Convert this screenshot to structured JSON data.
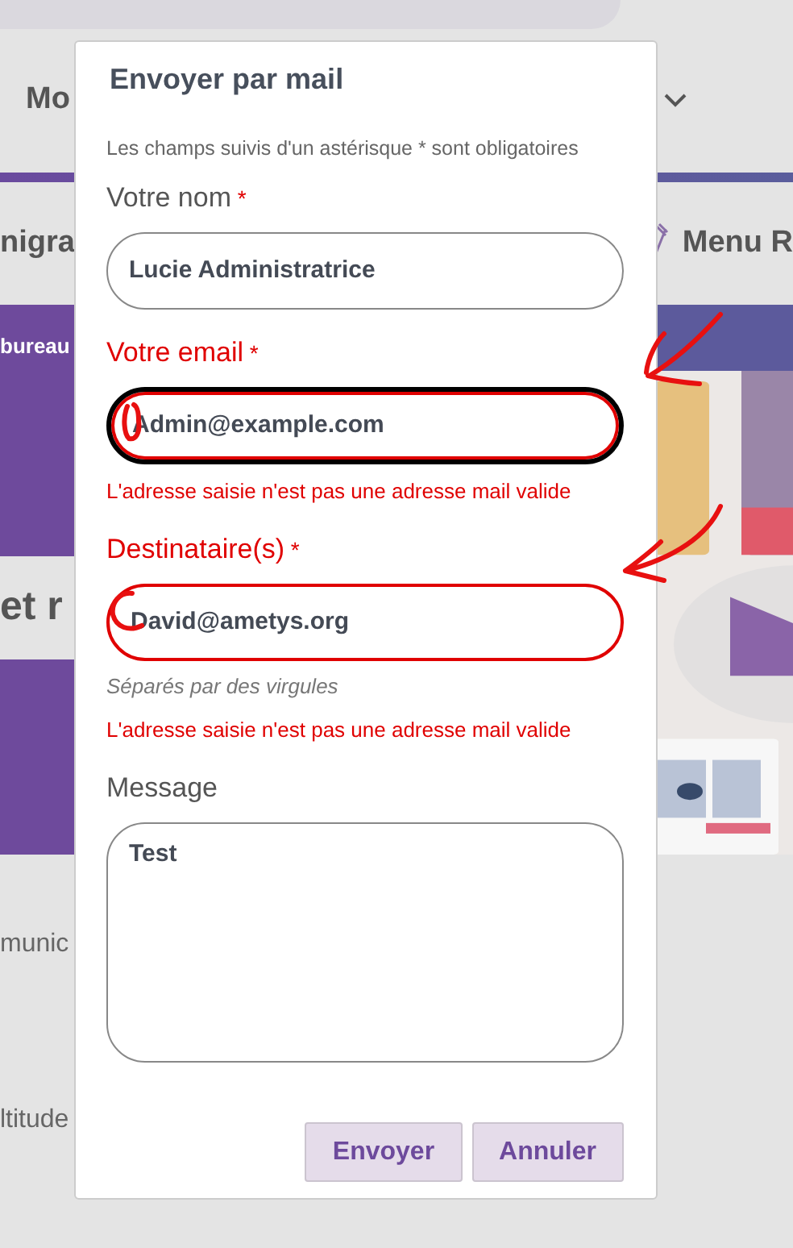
{
  "background": {
    "nav_text": "Mo",
    "row_left": "nigra",
    "row_right": "Menu R",
    "banner_text": "bureau",
    "headline": "et r",
    "text_1": "munic",
    "text_2": "ltitude"
  },
  "dialog": {
    "title": "Envoyer par mail",
    "required_note": "Les champs suivis d'un astérisque * sont obligatoires",
    "asterisk": "*",
    "fields": [
      {
        "kind": "input",
        "label": "Votre nom",
        "required": true,
        "invalid": false,
        "focused": false,
        "value": "Lucie Administratrice"
      },
      {
        "kind": "input",
        "label": "Votre email",
        "required": true,
        "invalid": true,
        "focused": true,
        "value": "Admin@example.com",
        "error": "L'adresse saisie n'est pas une adresse mail valide"
      },
      {
        "kind": "input",
        "label": "Destinataire(s)",
        "required": true,
        "invalid": true,
        "focused": false,
        "value": "David@ametys.org",
        "hint": "Séparés par des virgules",
        "error": "L'adresse saisie n'est pas une adresse mail valide"
      },
      {
        "kind": "textarea",
        "label": "Message",
        "required": false,
        "invalid": false,
        "focused": false,
        "value": "Test"
      }
    ],
    "buttons": [
      "Envoyer",
      "Annuler"
    ]
  }
}
